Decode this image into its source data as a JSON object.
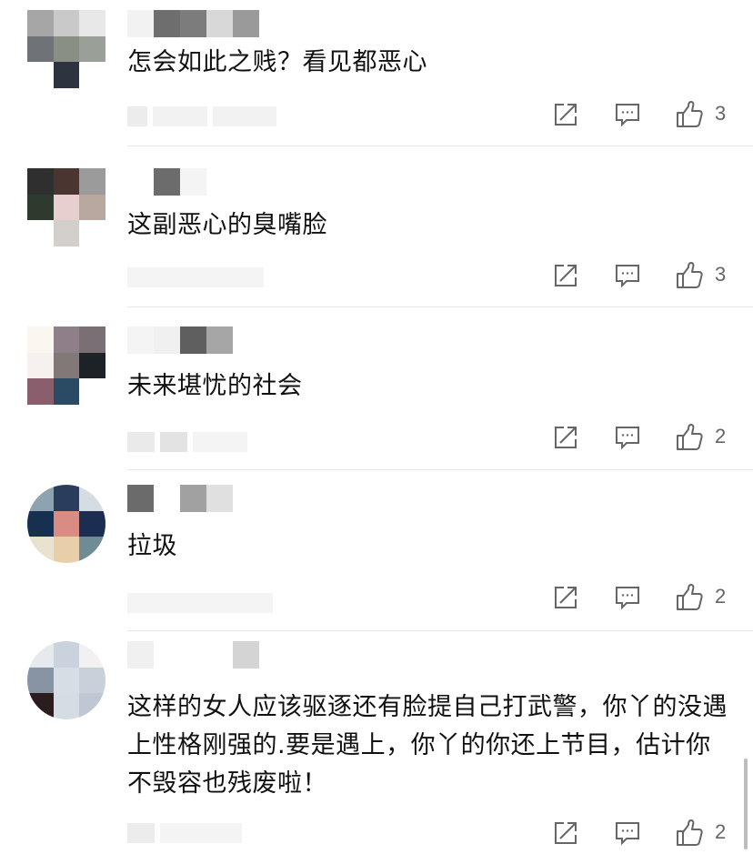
{
  "comments": [
    {
      "text": "怎会如此之贱？看见都恶心",
      "likes": "3",
      "avatar_colors": [
        "#a6a6a6",
        "#c9c9c9",
        "#e8e8e8",
        "#6f7378",
        "#8a8f85",
        "#9aa097",
        "#ffffff",
        "#2d3440",
        "#ffffff"
      ],
      "username_colors": [
        "#f2f2f2",
        "#6e6e6e",
        "#7c7c7c",
        "#d8d8d8",
        "#9a9a9a"
      ]
    },
    {
      "text": "这副恶心的臭嘴脸",
      "likes": "3",
      "avatar_colors": [
        "#2f2f2f",
        "#4a3530",
        "#9b9b9b",
        "#2e3a2e",
        "#e7cfd0",
        "#b8a89f",
        "#ffffff",
        "#d3cfca",
        "#ffffff"
      ],
      "username_colors": [
        "#ffffff",
        "#6c6c6c",
        "#f4f4f4"
      ]
    },
    {
      "text": "未来堪忧的社会",
      "likes": "2",
      "avatar_colors": [
        "#fbf6f0",
        "#8f7f88",
        "#7b6f76",
        "#f6f1ee",
        "#807977",
        "#1d2227",
        "#8a5e6c",
        "#2a4b63",
        "#ffffff"
      ],
      "username_colors": [
        "#f4f4f4",
        "#f0f0f0",
        "#5f5f5f",
        "#a6a6a6"
      ]
    },
    {
      "text": "拉圾",
      "likes": "2",
      "avatar_colors": [
        "#8ea3b0",
        "#2a3d5c",
        "#d6dde2",
        "#17304f",
        "#d98d82",
        "#1b2e52",
        "#e9e2cf",
        "#e8cfaa",
        "#6f8b93"
      ],
      "username_colors": [
        "#6b6b6b",
        "#ffffff",
        "#a1a1a1",
        "#e0e0e0"
      ]
    },
    {
      "text": "这样的女人应该驱逐还有脸提自己打武警，你丫的没遇上性格刚强的.要是遇上，你丫的你还上节目，估计你不毁容也残废啦！",
      "likes": "2",
      "avatar_colors": [
        "#e6eaef",
        "#c9d2dd",
        "#f1f1f1",
        "#8894a4",
        "#d7dde5",
        "#c8d0da",
        "#2b1d1f",
        "#d6dce3",
        "#bfc8d2"
      ],
      "username_colors": [
        "#f0f0f0",
        "#ffffff",
        "#ffffff",
        "#ffffff",
        "#d4d4d4"
      ]
    }
  ],
  "icons": {
    "share": "share-icon",
    "reply": "comment-icon",
    "like": "thumbs-up-icon"
  }
}
